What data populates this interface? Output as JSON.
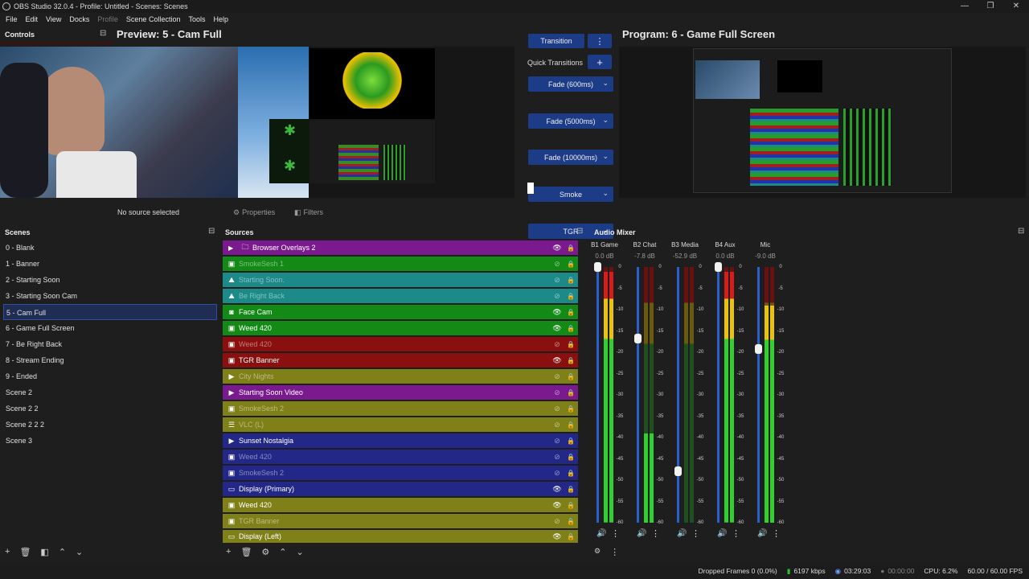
{
  "window": {
    "title": "OBS Studio 32.0.4 - Profile: Untitled - Scenes: Scenes",
    "min": "—",
    "max": "❐",
    "close": "✕"
  },
  "menu": [
    "File",
    "Edit",
    "View",
    "Docks",
    "Profile",
    "Scene Collection",
    "Tools",
    "Help"
  ],
  "controls": {
    "title": "Controls"
  },
  "preview": {
    "title": "Preview: 5 - Cam Full"
  },
  "program": {
    "title": "Program: 6 - Game Full Screen"
  },
  "transitions": {
    "transition_label": "Transition",
    "quick_label": "Quick Transitions",
    "items": [
      "Fade (600ms)",
      "Fade (5000ms)",
      "Fade (10000ms)",
      "Smoke",
      "TGR"
    ]
  },
  "source_toolbar": {
    "no_source": "No source selected",
    "properties": "Properties",
    "filters": "Filters"
  },
  "scenes": {
    "title": "Scenes",
    "items": [
      "0 - Blank",
      "1 - Banner",
      "2 - Starting Soon",
      "3 - Starting Soon Cam",
      "5 - Cam Full",
      "6 - Game Full Screen",
      "7 - Be Right Back",
      "8 - Stream Ending",
      "9 - Ended",
      "Scene 2",
      "Scene 2 2",
      "Scene 2 2 2",
      "Scene 3"
    ],
    "selected": "5 - Cam Full"
  },
  "sources": {
    "title": "Sources",
    "items": [
      {
        "name": "Browser Overlays 2",
        "color": "#7a1a8e",
        "icon": "folder-icon",
        "visible": true,
        "group": true
      },
      {
        "name": "SmokeSesh 1",
        "color": "#148a16",
        "icon": "image-icon",
        "visible": false
      },
      {
        "name": "Starting Soon.",
        "color": "#1c8a88",
        "icon": "scene-icon",
        "visible": false
      },
      {
        "name": "Be Right Back",
        "color": "#1c8a88",
        "icon": "scene-icon",
        "visible": false
      },
      {
        "name": "Face Cam",
        "color": "#148a16",
        "icon": "camera-icon",
        "visible": true
      },
      {
        "name": "Weed 420",
        "color": "#148a16",
        "icon": "image-icon",
        "visible": true
      },
      {
        "name": "Weed 420",
        "color": "#8a0f0f",
        "icon": "image-icon",
        "visible": false
      },
      {
        "name": "TGR Banner",
        "color": "#8a0f0f",
        "icon": "image-icon",
        "visible": true
      },
      {
        "name": "City Nights",
        "color": "#808018",
        "icon": "play-icon",
        "visible": false
      },
      {
        "name": "Starting Soon Video",
        "color": "#7a1a8e",
        "icon": "play-icon",
        "visible": false
      },
      {
        "name": "SmokeSesh 2",
        "color": "#808018",
        "icon": "image-icon",
        "visible": false
      },
      {
        "name": "VLC (L)",
        "color": "#808018",
        "icon": "list-icon",
        "visible": false
      },
      {
        "name": "Sunset Nostalgia",
        "color": "#232888",
        "icon": "play-icon",
        "visible": false
      },
      {
        "name": "Weed 420",
        "color": "#232888",
        "icon": "image-icon",
        "visible": false
      },
      {
        "name": "SmokeSesh 2",
        "color": "#232888",
        "icon": "image-icon",
        "visible": false
      },
      {
        "name": "Display (Primary)",
        "color": "#232888",
        "icon": "monitor-icon",
        "visible": true
      },
      {
        "name": "Weed 420",
        "color": "#808018",
        "icon": "image-icon",
        "visible": true
      },
      {
        "name": "TGR Banner",
        "color": "#808018",
        "icon": "image-icon",
        "visible": false
      },
      {
        "name": "Display (Left)",
        "color": "#808018",
        "icon": "monitor-icon",
        "visible": true
      }
    ]
  },
  "audio": {
    "title": "Audio Mixer",
    "ticks": [
      "0",
      "-5",
      "-10",
      "-15",
      "-20",
      "-25",
      "-30",
      "-35",
      "-40",
      "-45",
      "-50",
      "-55",
      "-60"
    ],
    "channels": [
      {
        "name": "B1 Game",
        "db": "0.0 dB",
        "level": 0.98,
        "fader": 1.0
      },
      {
        "name": "B2 Chat",
        "db": "-7.8 dB",
        "level": 0.35,
        "fader": 0.72
      },
      {
        "name": "B3 Media",
        "db": "-52.9 dB",
        "level": 0.0,
        "fader": 0.2
      },
      {
        "name": "B4 Aux",
        "db": "0.0 dB",
        "level": 0.98,
        "fader": 1.0
      },
      {
        "name": "Mic",
        "db": "-9.0 dB",
        "level": 0.85,
        "fader": 0.68
      }
    ]
  },
  "status": {
    "dropped": "Dropped Frames 0 (0.0%)",
    "bitrate": "6197 kbps",
    "stream_time": "03:29:03",
    "rec_time": "00:00:00",
    "cpu": "CPU: 6.2%",
    "fps": "60.00 / 60.00 FPS"
  }
}
